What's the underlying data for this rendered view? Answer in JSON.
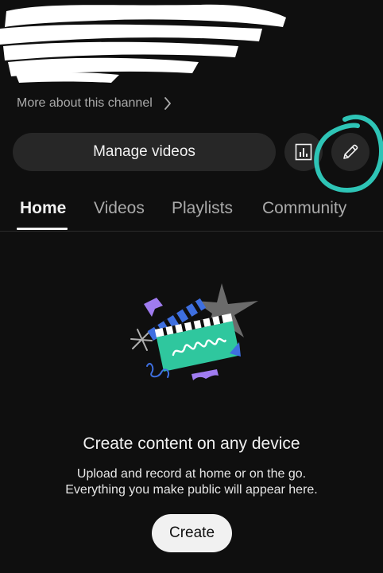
{
  "channel": {
    "more_about": "More about this channel"
  },
  "actions": {
    "manage_videos": "Manage videos",
    "analytics_icon": "bar-chart-icon",
    "edit_icon": "pencil-icon",
    "highlight_color": "#2ec4b6"
  },
  "tabs": [
    {
      "label": "Home",
      "active": true
    },
    {
      "label": "Videos",
      "active": false
    },
    {
      "label": "Playlists",
      "active": false
    },
    {
      "label": "Community",
      "active": false
    }
  ],
  "empty_state": {
    "illustration": "clapperboard-illustration",
    "title": "Create content on any device",
    "description_line1": "Upload and record at home or on the go.",
    "description_line2": "Everything you make public will appear here.",
    "create_button": "Create"
  }
}
